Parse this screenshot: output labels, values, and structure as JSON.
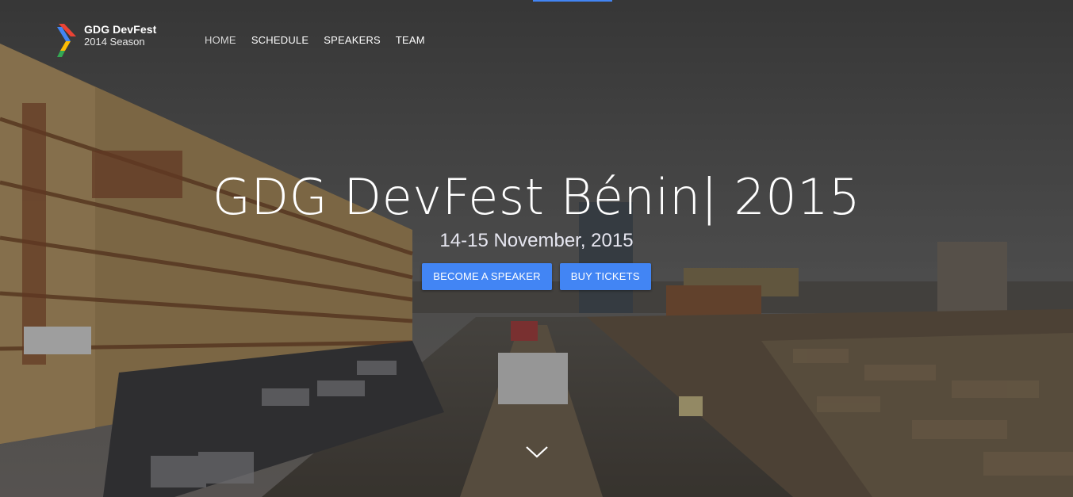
{
  "brand": {
    "title": "GDG DevFest",
    "subtitle": "2014 Season",
    "colors": {
      "blue": "#4285f4",
      "red": "#ea4335",
      "yellow": "#fbbc05",
      "green": "#34a853"
    }
  },
  "nav": {
    "items": [
      {
        "label": "HOME",
        "active": true
      },
      {
        "label": "SCHEDULE"
      },
      {
        "label": "SPEAKERS"
      },
      {
        "label": "TEAM"
      }
    ]
  },
  "hero": {
    "title": "GDG DevFest Bénin| 2015",
    "date": "14-15 November, 2015",
    "buttons": {
      "speaker": "BECOME A SPEAKER",
      "tickets": "BUY TICKETS"
    },
    "scroll_icon": "chevron-down-icon",
    "accent": "#4285f4"
  }
}
